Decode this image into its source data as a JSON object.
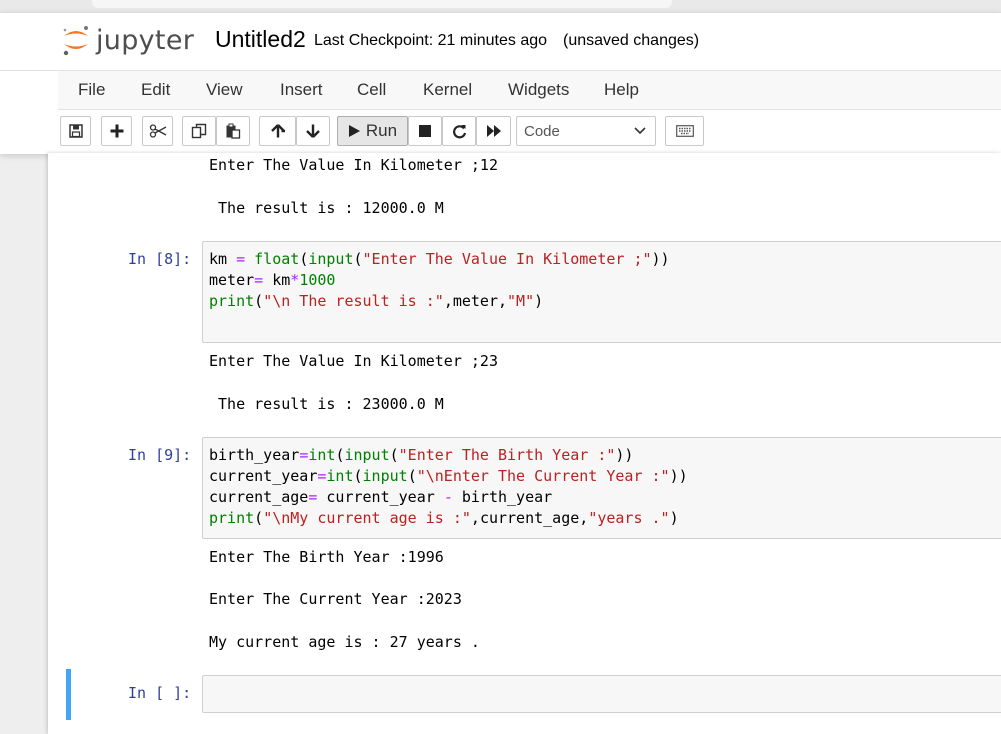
{
  "header": {
    "logo_text": "jupyter",
    "notebook_title": "Untitled2",
    "checkpoint": "Last Checkpoint: 21 minutes ago",
    "unsaved": "(unsaved changes)"
  },
  "menu": [
    "File",
    "Edit",
    "View",
    "Insert",
    "Cell",
    "Kernel",
    "Widgets",
    "Help"
  ],
  "toolbar": {
    "run_label": "Run",
    "cell_type": "Code",
    "icons": [
      "save-icon",
      "plus-icon",
      "scissors-icon",
      "copy-icon",
      "paste-icon",
      "arrow-up-icon",
      "arrow-down-icon",
      "play-icon",
      "stop-icon",
      "restart-icon",
      "fast-forward-icon",
      "keyboard-icon"
    ]
  },
  "cells": {
    "prev_output": [
      "Enter The Value In Kilometer ;12",
      " The result is : 12000.0 M"
    ],
    "cell8": {
      "prompt": "In [8]:",
      "code": [
        "km = float(input(\"Enter The Value In Kilometer ;\"))",
        "meter= km*1000",
        "print(\"\\n The result is :\",meter,\"M\")"
      ],
      "output": [
        "Enter The Value In Kilometer ;23",
        " The result is : 23000.0 M"
      ]
    },
    "cell9": {
      "prompt": "In [9]:",
      "code": [
        "birth_year=int(input(\"Enter The Birth Year :\"))",
        "current_year=int(input(\"\\nEnter The Current Year :\"))",
        "current_age= current_year - birth_year",
        "print(\"\\nMy current age is :\",current_age,\"years .\")"
      ],
      "output": [
        "Enter The Birth Year :1996",
        "Enter The Current Year :2023",
        "My current age is : 27 years ."
      ]
    },
    "empty_cell": {
      "prompt": "In [ ]:"
    }
  },
  "colors": {
    "prompt": "#303f9f",
    "keyword_builtin": "#008000",
    "string": "#ba2121",
    "operator": "#aa22ff",
    "selected_cell_bar": "#42a5f5"
  }
}
